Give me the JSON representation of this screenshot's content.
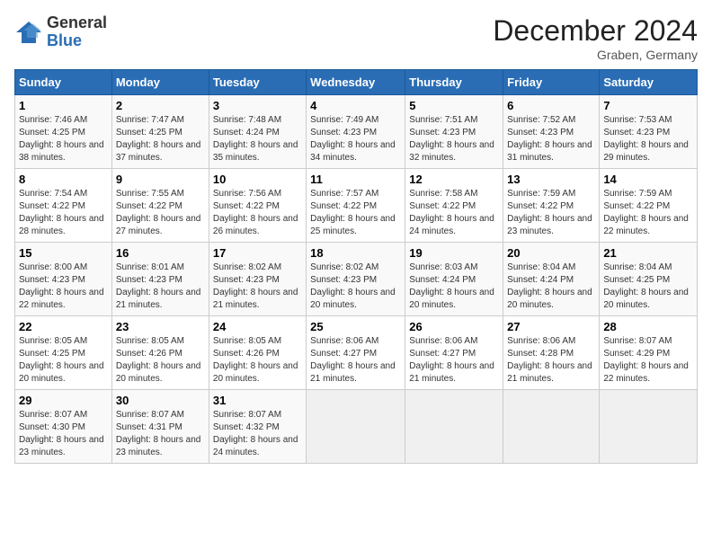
{
  "header": {
    "logo_general": "General",
    "logo_blue": "Blue",
    "month_year": "December 2024",
    "location": "Graben, Germany"
  },
  "days_of_week": [
    "Sunday",
    "Monday",
    "Tuesday",
    "Wednesday",
    "Thursday",
    "Friday",
    "Saturday"
  ],
  "weeks": [
    [
      {
        "day": "1",
        "sunrise": "Sunrise: 7:46 AM",
        "sunset": "Sunset: 4:25 PM",
        "daylight": "Daylight: 8 hours and 38 minutes."
      },
      {
        "day": "2",
        "sunrise": "Sunrise: 7:47 AM",
        "sunset": "Sunset: 4:25 PM",
        "daylight": "Daylight: 8 hours and 37 minutes."
      },
      {
        "day": "3",
        "sunrise": "Sunrise: 7:48 AM",
        "sunset": "Sunset: 4:24 PM",
        "daylight": "Daylight: 8 hours and 35 minutes."
      },
      {
        "day": "4",
        "sunrise": "Sunrise: 7:49 AM",
        "sunset": "Sunset: 4:23 PM",
        "daylight": "Daylight: 8 hours and 34 minutes."
      },
      {
        "day": "5",
        "sunrise": "Sunrise: 7:51 AM",
        "sunset": "Sunset: 4:23 PM",
        "daylight": "Daylight: 8 hours and 32 minutes."
      },
      {
        "day": "6",
        "sunrise": "Sunrise: 7:52 AM",
        "sunset": "Sunset: 4:23 PM",
        "daylight": "Daylight: 8 hours and 31 minutes."
      },
      {
        "day": "7",
        "sunrise": "Sunrise: 7:53 AM",
        "sunset": "Sunset: 4:23 PM",
        "daylight": "Daylight: 8 hours and 29 minutes."
      }
    ],
    [
      {
        "day": "8",
        "sunrise": "Sunrise: 7:54 AM",
        "sunset": "Sunset: 4:22 PM",
        "daylight": "Daylight: 8 hours and 28 minutes."
      },
      {
        "day": "9",
        "sunrise": "Sunrise: 7:55 AM",
        "sunset": "Sunset: 4:22 PM",
        "daylight": "Daylight: 8 hours and 27 minutes."
      },
      {
        "day": "10",
        "sunrise": "Sunrise: 7:56 AM",
        "sunset": "Sunset: 4:22 PM",
        "daylight": "Daylight: 8 hours and 26 minutes."
      },
      {
        "day": "11",
        "sunrise": "Sunrise: 7:57 AM",
        "sunset": "Sunset: 4:22 PM",
        "daylight": "Daylight: 8 hours and 25 minutes."
      },
      {
        "day": "12",
        "sunrise": "Sunrise: 7:58 AM",
        "sunset": "Sunset: 4:22 PM",
        "daylight": "Daylight: 8 hours and 24 minutes."
      },
      {
        "day": "13",
        "sunrise": "Sunrise: 7:59 AM",
        "sunset": "Sunset: 4:22 PM",
        "daylight": "Daylight: 8 hours and 23 minutes."
      },
      {
        "day": "14",
        "sunrise": "Sunrise: 7:59 AM",
        "sunset": "Sunset: 4:22 PM",
        "daylight": "Daylight: 8 hours and 22 minutes."
      }
    ],
    [
      {
        "day": "15",
        "sunrise": "Sunrise: 8:00 AM",
        "sunset": "Sunset: 4:23 PM",
        "daylight": "Daylight: 8 hours and 22 minutes."
      },
      {
        "day": "16",
        "sunrise": "Sunrise: 8:01 AM",
        "sunset": "Sunset: 4:23 PM",
        "daylight": "Daylight: 8 hours and 21 minutes."
      },
      {
        "day": "17",
        "sunrise": "Sunrise: 8:02 AM",
        "sunset": "Sunset: 4:23 PM",
        "daylight": "Daylight: 8 hours and 21 minutes."
      },
      {
        "day": "18",
        "sunrise": "Sunrise: 8:02 AM",
        "sunset": "Sunset: 4:23 PM",
        "daylight": "Daylight: 8 hours and 20 minutes."
      },
      {
        "day": "19",
        "sunrise": "Sunrise: 8:03 AM",
        "sunset": "Sunset: 4:24 PM",
        "daylight": "Daylight: 8 hours and 20 minutes."
      },
      {
        "day": "20",
        "sunrise": "Sunrise: 8:04 AM",
        "sunset": "Sunset: 4:24 PM",
        "daylight": "Daylight: 8 hours and 20 minutes."
      },
      {
        "day": "21",
        "sunrise": "Sunrise: 8:04 AM",
        "sunset": "Sunset: 4:25 PM",
        "daylight": "Daylight: 8 hours and 20 minutes."
      }
    ],
    [
      {
        "day": "22",
        "sunrise": "Sunrise: 8:05 AM",
        "sunset": "Sunset: 4:25 PM",
        "daylight": "Daylight: 8 hours and 20 minutes."
      },
      {
        "day": "23",
        "sunrise": "Sunrise: 8:05 AM",
        "sunset": "Sunset: 4:26 PM",
        "daylight": "Daylight: 8 hours and 20 minutes."
      },
      {
        "day": "24",
        "sunrise": "Sunrise: 8:05 AM",
        "sunset": "Sunset: 4:26 PM",
        "daylight": "Daylight: 8 hours and 20 minutes."
      },
      {
        "day": "25",
        "sunrise": "Sunrise: 8:06 AM",
        "sunset": "Sunset: 4:27 PM",
        "daylight": "Daylight: 8 hours and 21 minutes."
      },
      {
        "day": "26",
        "sunrise": "Sunrise: 8:06 AM",
        "sunset": "Sunset: 4:27 PM",
        "daylight": "Daylight: 8 hours and 21 minutes."
      },
      {
        "day": "27",
        "sunrise": "Sunrise: 8:06 AM",
        "sunset": "Sunset: 4:28 PM",
        "daylight": "Daylight: 8 hours and 21 minutes."
      },
      {
        "day": "28",
        "sunrise": "Sunrise: 8:07 AM",
        "sunset": "Sunset: 4:29 PM",
        "daylight": "Daylight: 8 hours and 22 minutes."
      }
    ],
    [
      {
        "day": "29",
        "sunrise": "Sunrise: 8:07 AM",
        "sunset": "Sunset: 4:30 PM",
        "daylight": "Daylight: 8 hours and 23 minutes."
      },
      {
        "day": "30",
        "sunrise": "Sunrise: 8:07 AM",
        "sunset": "Sunset: 4:31 PM",
        "daylight": "Daylight: 8 hours and 23 minutes."
      },
      {
        "day": "31",
        "sunrise": "Sunrise: 8:07 AM",
        "sunset": "Sunset: 4:32 PM",
        "daylight": "Daylight: 8 hours and 24 minutes."
      },
      null,
      null,
      null,
      null
    ]
  ]
}
